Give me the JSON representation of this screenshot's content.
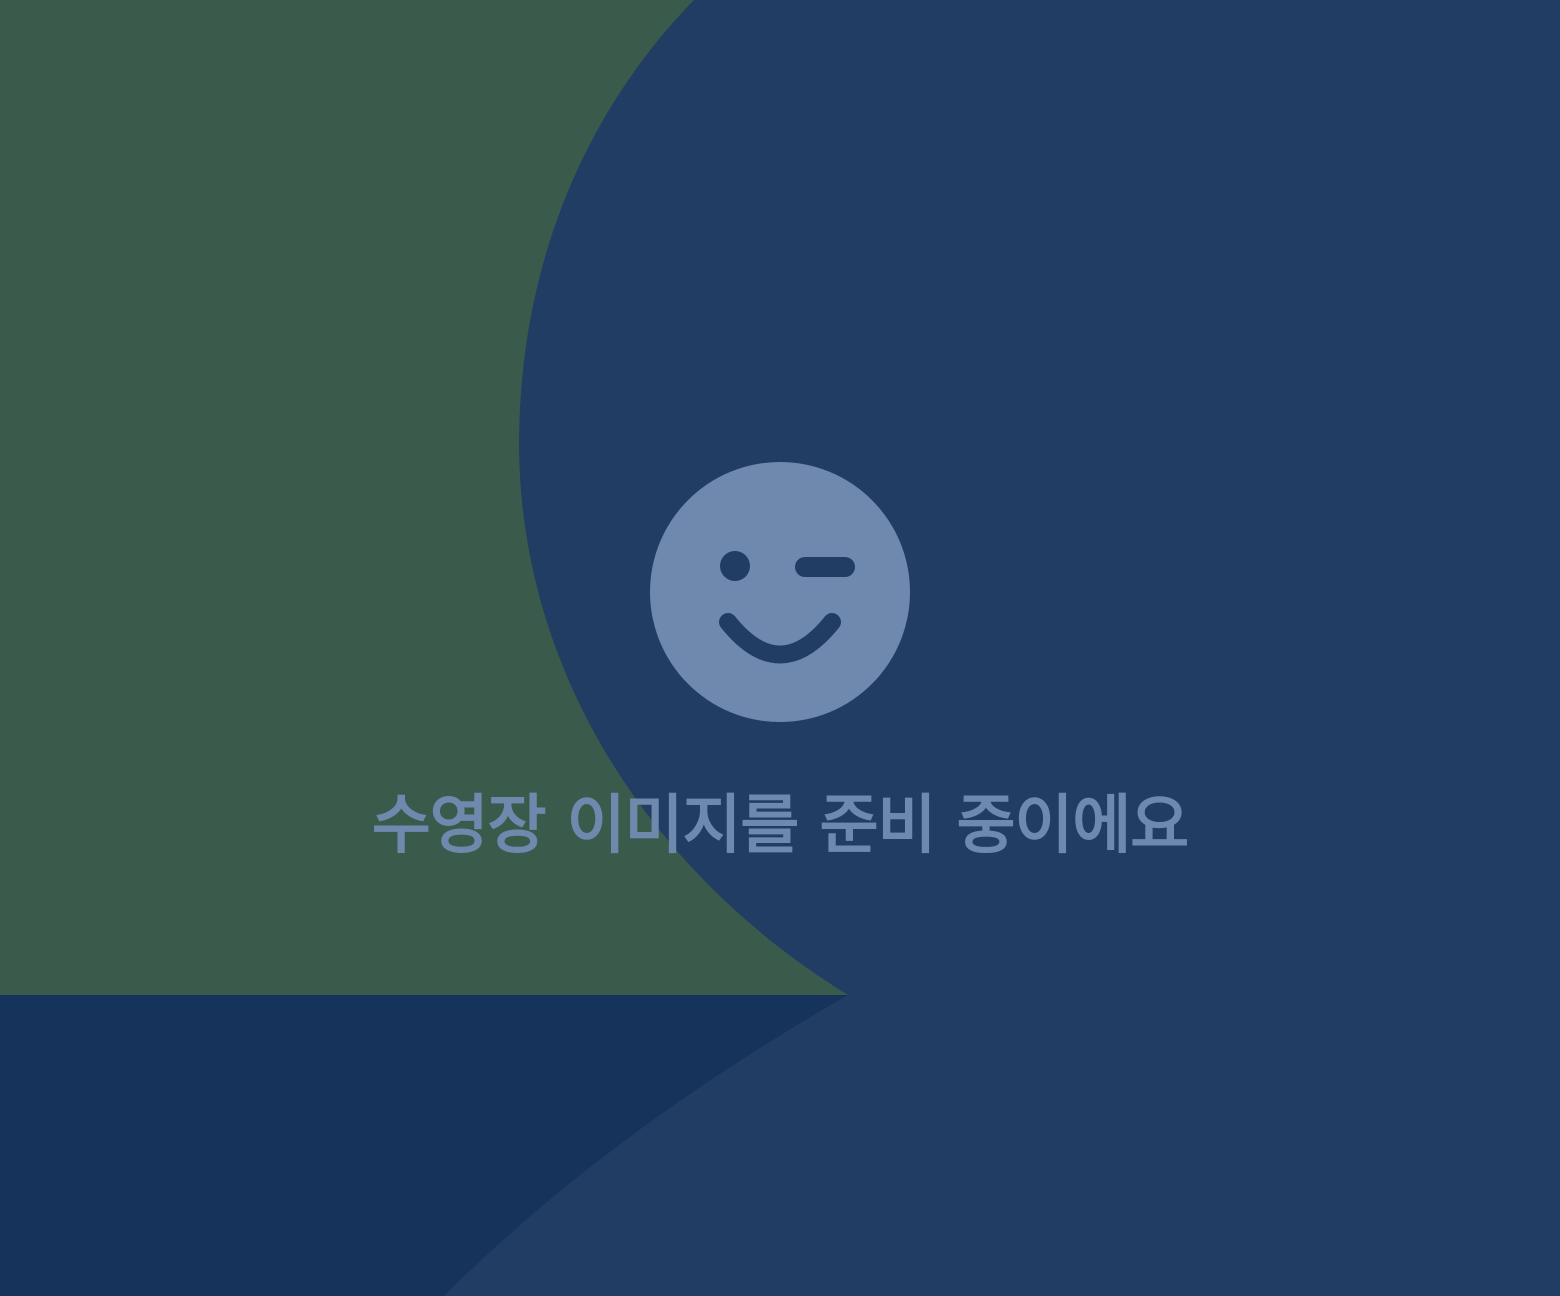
{
  "placeholder": {
    "message": "수영장 이미지를 준비 중이에요",
    "icon": "wink-face-icon"
  },
  "colors": {
    "background_blue": "#223d63",
    "background_green": "#3a5b4c",
    "background_navy": "#16345b",
    "icon_and_text": "#6f89ae",
    "icon_features": "#223d63"
  }
}
